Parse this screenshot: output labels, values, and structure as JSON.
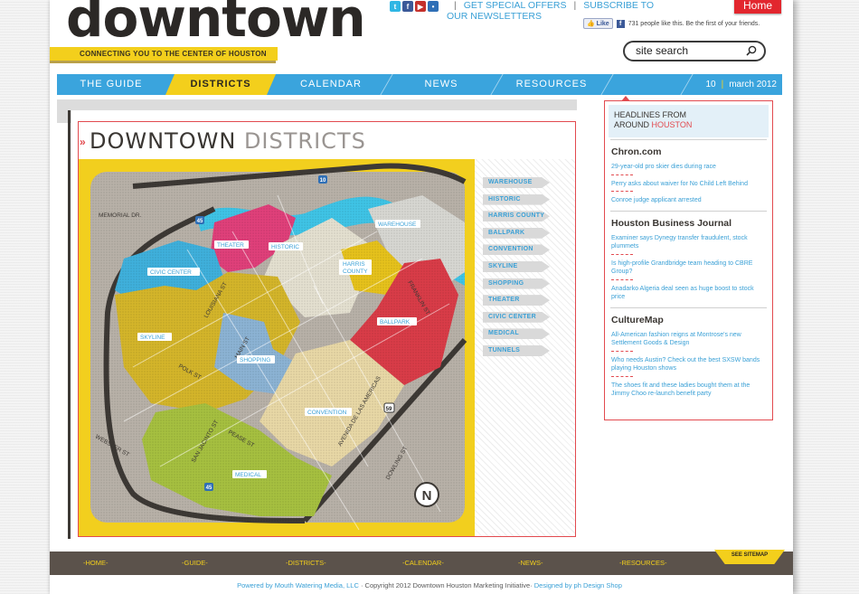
{
  "header": {
    "logo": "downtown",
    "tagline": "CONNECTING YOU TO THE CENTER OF HOUSTON",
    "special_offers": "GET SPECIAL OFFERS",
    "subscribe": "SUBSCRIBE TO OUR NEWSLETTERS",
    "home_button": "Home",
    "like_button": "Like",
    "like_text": "731 people like this. Be the first of your friends.",
    "search_value": "site search"
  },
  "social_icons": [
    "twitter-icon",
    "facebook-icon",
    "youtube-icon",
    "flickr-icon"
  ],
  "nav": {
    "items": [
      {
        "label": "THE GUIDE",
        "active": false
      },
      {
        "label": "DISTRICTS",
        "active": true
      },
      {
        "label": "CALENDAR",
        "active": false
      },
      {
        "label": "NEWS",
        "active": false
      },
      {
        "label": "RESOURCES",
        "active": false
      }
    ],
    "date_day": "10",
    "date_month": "march 2012"
  },
  "districts": {
    "title_dark": "DOWNTOWN",
    "title_light": "DISTRICTS",
    "list": [
      "WAREHOUSE",
      "HISTORIC",
      "HARRIS COUNTY",
      "BALLPARK",
      "CONVENTION",
      "SKYLINE",
      "SHOPPING",
      "THEATER",
      "CIVIC CENTER",
      "MEDICAL",
      "TUNNELS"
    ]
  },
  "map": {
    "labels": {
      "theater": "THEATER",
      "historic": "HISTORIC",
      "warehouse": "WAREHOUSE",
      "civic_center": "CIVIC CENTER",
      "harris": "HARRIS",
      "county": "COUNTY",
      "ballpark": "BALLPARK",
      "skyline": "SKYLINE",
      "shopping": "SHOPPING",
      "convention": "CONVENTION",
      "medical": "MEDICAL"
    },
    "streets": {
      "memorial": "MEMORIAL DR.",
      "louisiana": "LOUISIANA ST",
      "main": "MAIN ST",
      "polk": "POLK ST",
      "webster": "WEBSTER ST",
      "san_jacinto": "SAN JACINTO ST",
      "pease": "PEASE ST",
      "avenida": "AVENIDA DE LAS AMERICAS",
      "dowling": "DOWLING ST",
      "franklin": "FRANKLIN ST"
    },
    "shields": {
      "i45_top": "45",
      "i10": "10",
      "us59": "59",
      "i45_bottom": "45"
    },
    "compass": "N"
  },
  "sidebar": {
    "head_line1": "HEADLINES FROM",
    "head_line2_a": "AROUND",
    "head_line2_b": "HOUSTON",
    "sources": [
      {
        "name": "Chron.com",
        "headlines": [
          "29-year-old pro skier dies during race",
          "Perry asks about waiver for No Child Left Behind",
          "Conroe judge applicant arrested"
        ]
      },
      {
        "name": "Houston Business Journal",
        "headlines": [
          "Examiner says Dynegy transfer fraudulent, stock plummets",
          "Is high-profile Grandbridge team heading to CBRE Group?",
          "Anadarko Algeria deal seen as huge boost to stock price"
        ]
      },
      {
        "name": "CultureMap",
        "headlines": [
          "All-American fashion reigns at Montrose's new Settlement Goods & Design",
          "Who needs Austin? Check out the best SXSW bands playing Houston shows",
          "The shoes fit and these ladies bought them at the Jimmy Choo re-launch benefit party"
        ]
      }
    ]
  },
  "footer": {
    "items": [
      "-HOME-",
      "-GUIDE-",
      "-DISTRICTS-",
      "-CALENDAR-",
      "-NEWS-",
      "-RESOURCES-"
    ],
    "sitemap": "SEE SITEMAP",
    "powered": "Powered by Mouth Watering Media, LLC",
    "copyright": "· Copyright 2012 Downtown Houston Marketing Initiative·",
    "designed": "Designed by ph Design Shop"
  },
  "colors": {
    "accent_blue": "#3aa4dd",
    "accent_yellow": "#f3cf1c",
    "accent_red": "#e24a4f",
    "theater": "#e0407a",
    "civic": "#3fb0dc",
    "ballpark": "#d93c48",
    "shopping": "#8cb3d4",
    "medical": "#a6c040",
    "convention": "#e8d8a6",
    "historic": "#e4e0d0",
    "warehouse": "#d7d7d2"
  }
}
